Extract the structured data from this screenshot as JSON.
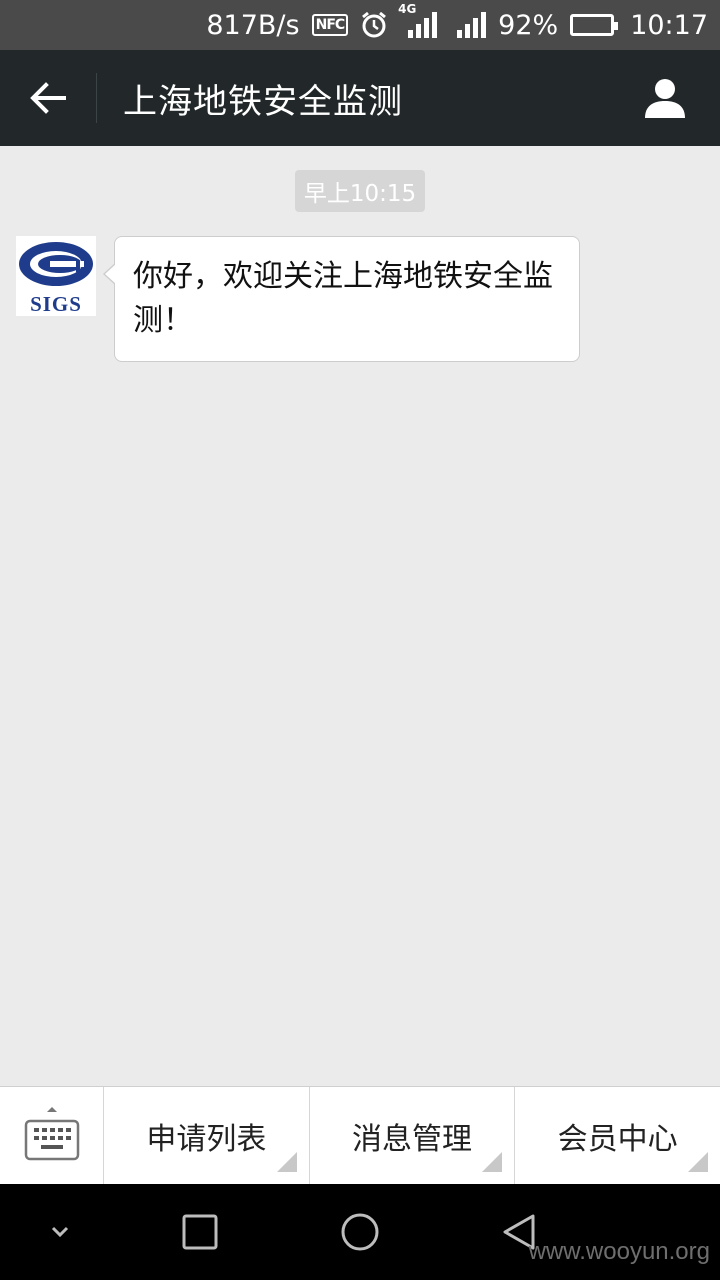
{
  "status_bar": {
    "net_speed": "817B/s",
    "nfc_label": "NFC",
    "network_type": "4G",
    "battery_percent": "92%",
    "battery_level": 0.92,
    "time": "10:17",
    "icons": [
      "nfc-icon",
      "alarm-icon",
      "signal-4g-icon",
      "signal-icon",
      "battery-icon"
    ]
  },
  "header": {
    "title": "上海地铁安全监测",
    "back_icon": "arrow-left-icon",
    "profile_icon": "person-icon"
  },
  "chat": {
    "timestamp": "早上10:15",
    "messages": [
      {
        "sender_avatar_text": "SIGS",
        "text": "你好，欢迎关注上海地铁安全监测！"
      }
    ]
  },
  "menu": {
    "keyboard_icon": "keyboard-icon",
    "items": [
      {
        "label": "申请列表"
      },
      {
        "label": "消息管理"
      },
      {
        "label": "会员中心"
      }
    ]
  },
  "nav_bar": {
    "icons": [
      "hide-keyboard-icon",
      "recents-icon",
      "home-icon",
      "back-icon"
    ]
  },
  "watermark": "www.wooyun.org",
  "colors": {
    "header_bg": "#222829",
    "status_bg": "#4a4a4a",
    "chat_bg": "#ebebeb",
    "logo_blue": "#1f3c8c"
  }
}
